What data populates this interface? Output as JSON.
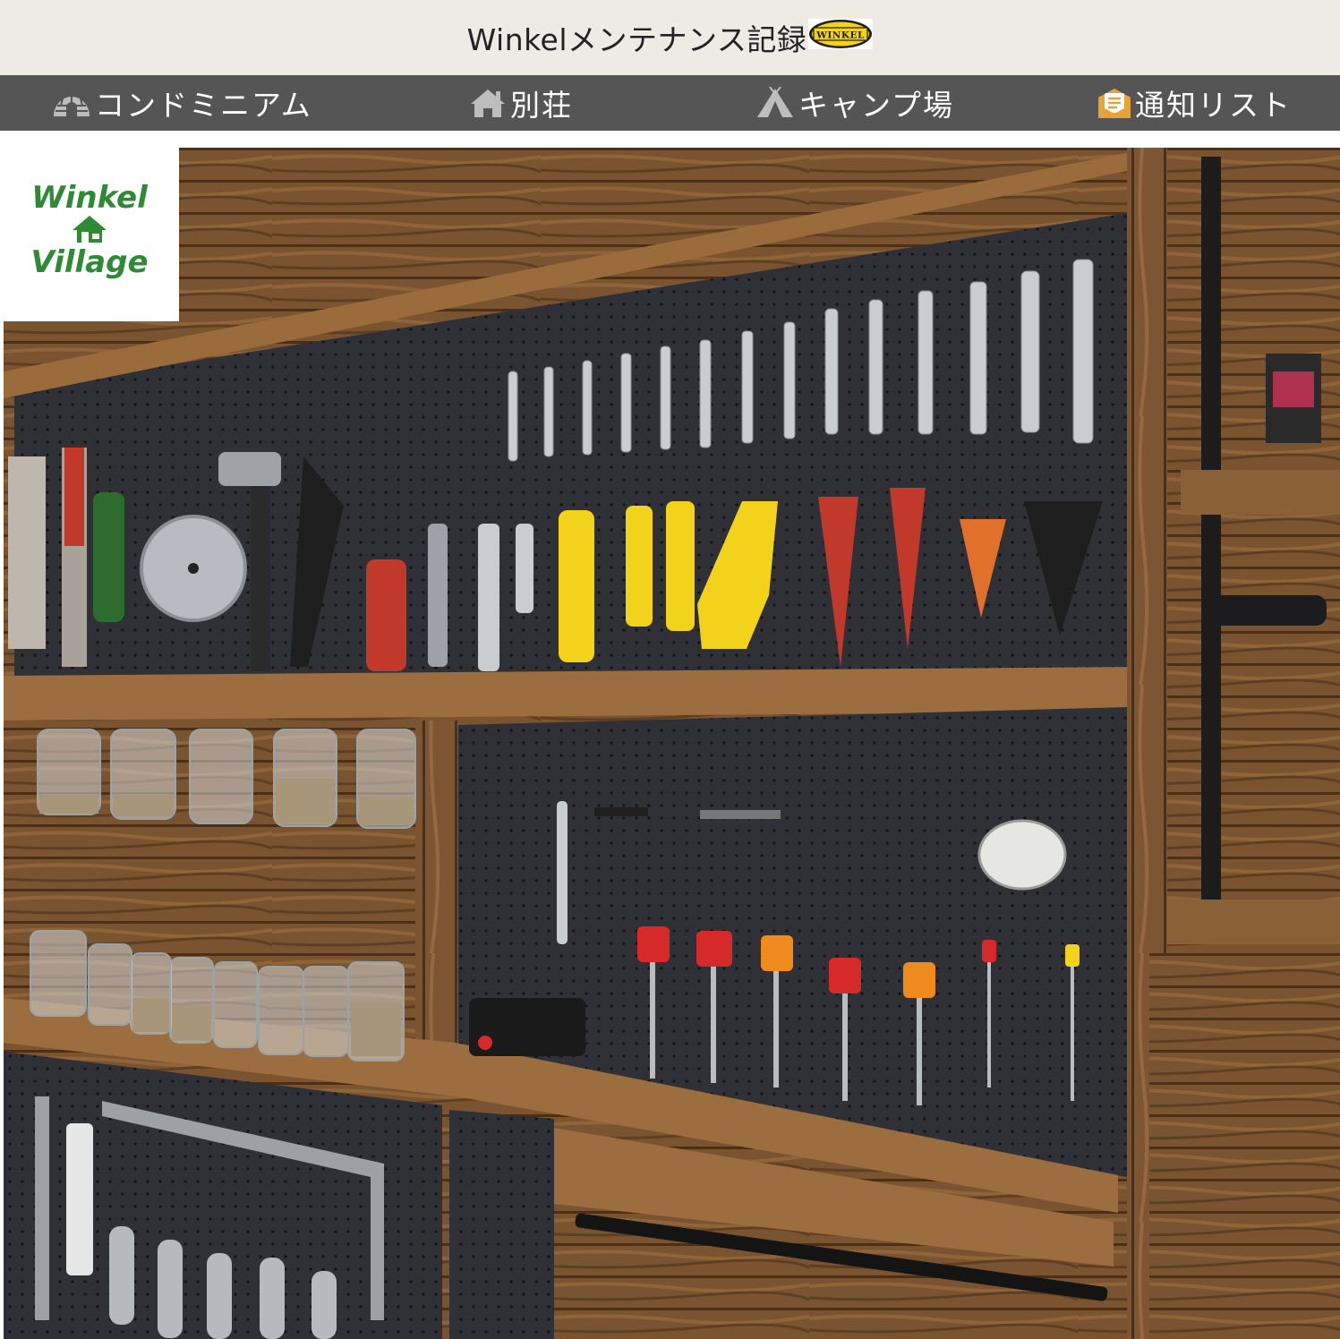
{
  "header": {
    "site_title": "Winkelメンテナンス記録",
    "brand_badge": "WINKEL"
  },
  "nav": {
    "items": [
      {
        "label": "コンドミニアム",
        "icon": "igloo-icon"
      },
      {
        "label": "別荘",
        "icon": "house-icon"
      },
      {
        "label": "キャンプ場",
        "icon": "tent-icon"
      },
      {
        "label": "通知リスト",
        "icon": "mail-list-icon"
      }
    ]
  },
  "logo": {
    "line1": "Winkel",
    "line2": "Village"
  },
  "hero": {
    "description_icon": "tool-wall-photo"
  },
  "colors": {
    "topbar_bg": "#eeebe5",
    "nav_bg": "#555555",
    "nav_text": "#ffffff",
    "nav_icon": "#bdbdbd",
    "notice_icon": "#e8a23a",
    "logo_green": "#2f8a35",
    "badge_yellow": "#f2d21b"
  }
}
